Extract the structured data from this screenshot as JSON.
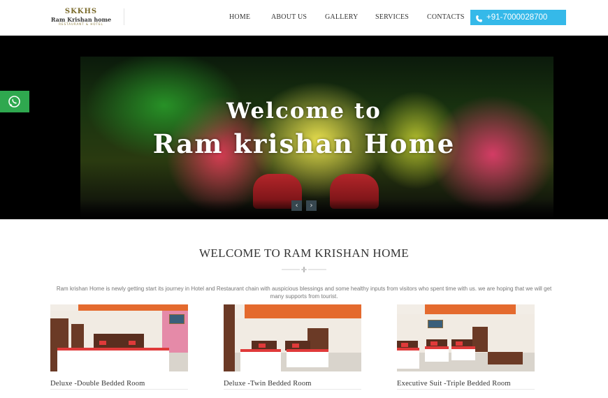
{
  "header": {
    "logo": {
      "ornament": "SKKHS",
      "name": "Ram Krishan home",
      "tagline": "RESTAURANT & HOTEL"
    },
    "nav": [
      {
        "label": "HOME"
      },
      {
        "label": "ABOUT US"
      },
      {
        "label": "GALLERY"
      },
      {
        "label": "SERVICES"
      },
      {
        "label": "CONTACTS"
      }
    ],
    "phone": {
      "label": "+91-7000028700",
      "icon": "phone-icon",
      "color": "#35b9e9"
    }
  },
  "hero": {
    "title_line1": "Welcome to",
    "title_line2": "Ram krishan Home",
    "prev_label": "‹",
    "next_label": "›"
  },
  "whatsapp": {
    "icon": "whatsapp-icon",
    "color": "#2fa84f"
  },
  "welcome": {
    "title": "WELCOME TO RAM KRISHAN HOME",
    "intro": "Ram krishan Home is newly getting start its journey in Hotel and Restaurant chain with auspicious blessings and some healthy inputs from visitors who spent time with us. we are hoping that we will get many supports from tourist."
  },
  "rooms": [
    {
      "name": "Deluxe -Double Bedded Room"
    },
    {
      "name": "Deluxe -Twin Bedded Room"
    },
    {
      "name": "Executive Suit -Triple Bedded Room"
    }
  ]
}
